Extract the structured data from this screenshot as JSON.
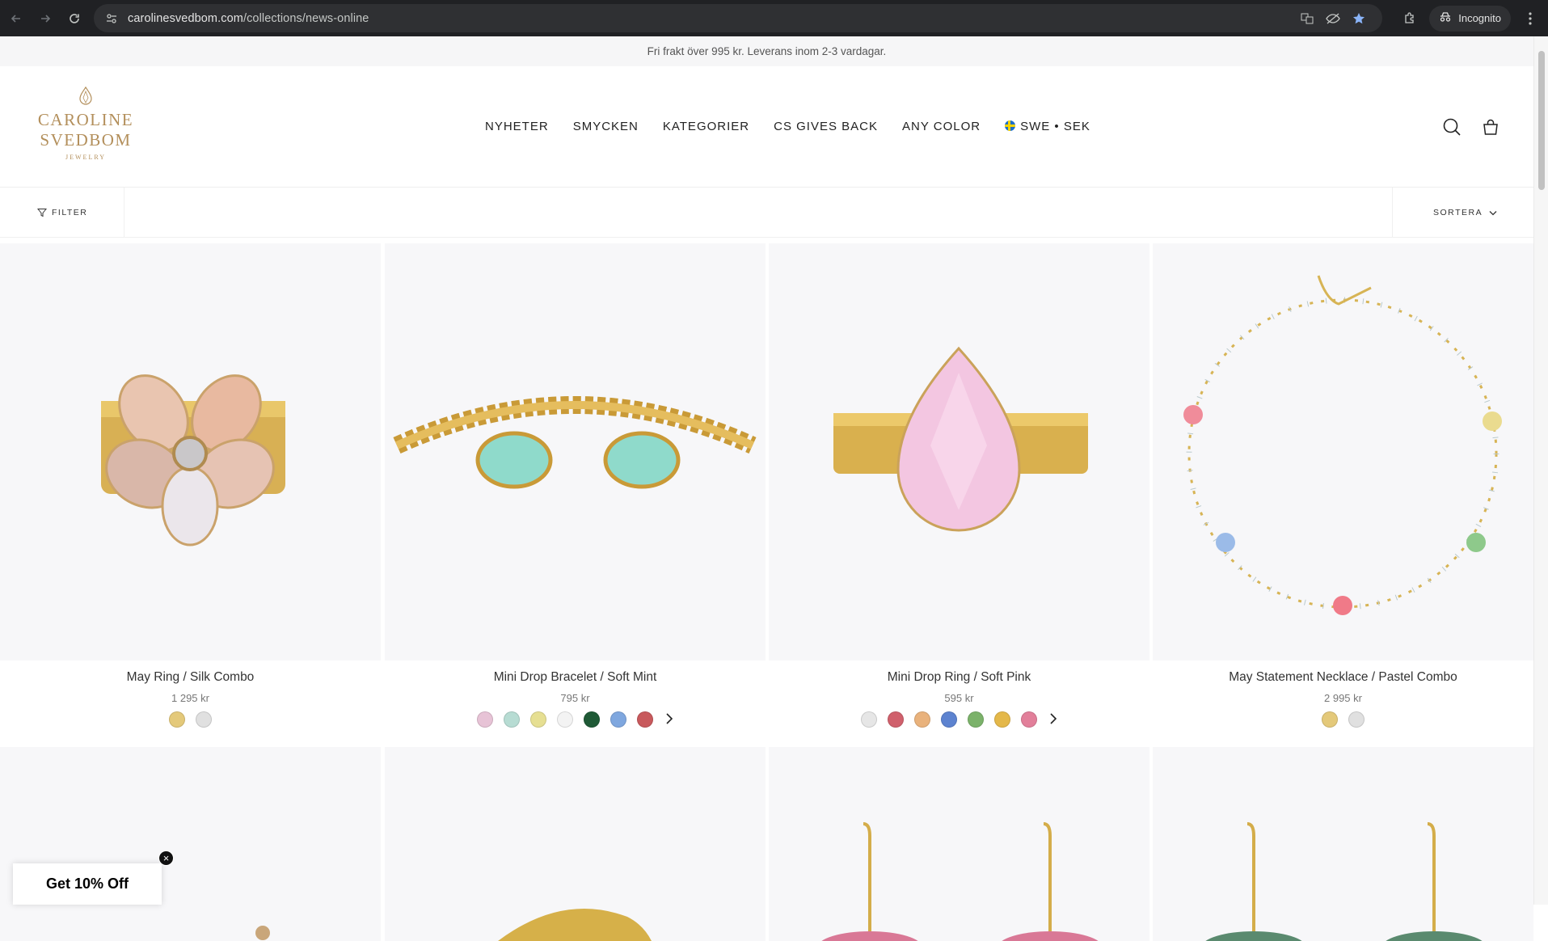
{
  "browser": {
    "url_host": "carolinesvedbom.com",
    "url_path": "/collections/news-online",
    "incognito_label": "Incognito"
  },
  "announcement": "Fri frakt över 995 kr. Leverans inom 2-3 vardagar.",
  "logo": {
    "line1": "CAROLINE",
    "line2": "SVEDBOM",
    "line3": "JEWELRY"
  },
  "nav": {
    "items": [
      "NYHETER",
      "SMYCKEN",
      "KATEGORIER",
      "CS GIVES BACK",
      "ANY COLOR"
    ],
    "locale": "SWE • SEK"
  },
  "filterbar": {
    "filter_label": "FILTER",
    "sort_label": "SORTERA"
  },
  "products": [
    {
      "title": "May Ring / Silk Combo",
      "price": "1 295 kr",
      "swatches": [
        "#e4c97a",
        "#e0e0e0"
      ],
      "more": false
    },
    {
      "title": "Mini Drop Bracelet / Soft Mint",
      "price": "795 kr",
      "swatches": [
        "#e7c3d6",
        "#b7dcd3",
        "#e6df92",
        "#f3f3f3",
        "#1f5a36",
        "#7fa7df",
        "#c8595c"
      ],
      "more": true
    },
    {
      "title": "Mini Drop Ring / Soft Pink",
      "price": "595 kr",
      "swatches": [
        "#e6e6e6",
        "#d0606c",
        "#e9b27c",
        "#5d83d0",
        "#7bb26a",
        "#e4b84a",
        "#e27f9a"
      ],
      "more": true
    },
    {
      "title": "May Statement Necklace / Pastel Combo",
      "price": "2 995 kr",
      "swatches": [
        "#e4c97a",
        "#e0e0e0"
      ],
      "more": false
    }
  ],
  "promo": {
    "label": "Get 10% Off",
    "close": "×"
  }
}
